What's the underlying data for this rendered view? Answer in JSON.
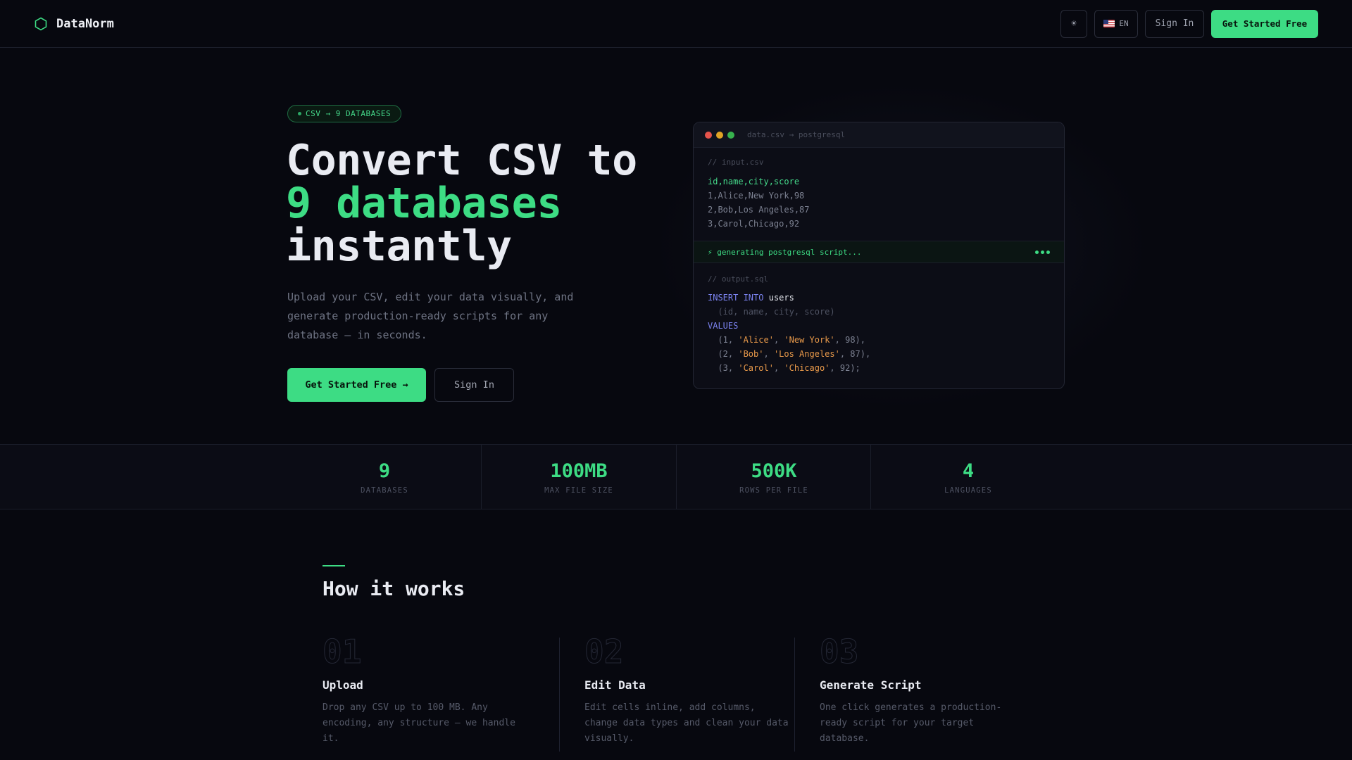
{
  "nav": {
    "brand": "DataNorm",
    "theme_icon": "sun-icon",
    "lang_code": "EN",
    "sign_in": "Sign In",
    "get_started": "Get Started Free"
  },
  "hero": {
    "badge": "CSV → 9 DATABASES",
    "title_line1": "Convert CSV to",
    "title_line2": "9 databases",
    "title_line3": "instantly",
    "subtitle": "Upload your CSV, edit your data visually, and generate production-ready scripts for any database — in seconds.",
    "cta_primary": "Get Started Free →",
    "cta_secondary": "Sign In"
  },
  "code_window": {
    "title": "data.csv → postgresql",
    "input_comment": "// input.csv",
    "csv_header": "id,name,city,score",
    "csv_rows": [
      "1,Alice,New York,98",
      "2,Bob,Los Angeles,87",
      "3,Carol,Chicago,92"
    ],
    "status": "⚡ generating postgresql script...",
    "output_comment": "// output.sql",
    "sql": {
      "insert_kw": "INSERT INTO",
      "table": "users",
      "columns": "(id, name, city, score)",
      "values_kw": "VALUES",
      "rows": [
        {
          "open": "(1, ",
          "name": "'Alice'",
          "sep": ", ",
          "city": "'New York'",
          "tail": ", 98),"
        },
        {
          "open": "(2, ",
          "name": "'Bob'",
          "sep": ", ",
          "city": "'Los Angeles'",
          "tail": ", 87),"
        },
        {
          "open": "(3, ",
          "name": "'Carol'",
          "sep": ", ",
          "city": "'Chicago'",
          "tail": ", 92);"
        }
      ]
    }
  },
  "stats": [
    {
      "value": "9",
      "label": "DATABASES"
    },
    {
      "value": "100MB",
      "label": "MAX FILE SIZE"
    },
    {
      "value": "500K",
      "label": "ROWS PER FILE"
    },
    {
      "value": "4",
      "label": "LANGUAGES"
    }
  ],
  "how_it_works": {
    "title": "How it works",
    "steps": [
      {
        "num": "01",
        "title": "Upload",
        "desc": "Drop any CSV up to 100 MB. Any encoding, any structure — we handle it."
      },
      {
        "num": "02",
        "title": "Edit Data",
        "desc": "Edit cells inline, add columns, change data types and clean your data visually."
      },
      {
        "num": "03",
        "title": "Generate Script",
        "desc": "One click generates a production-ready script for your target database."
      }
    ]
  },
  "colors": {
    "accent": "#3ddc84",
    "background": "#07080f",
    "sql_keyword": "#7b83f0",
    "sql_string": "#e8994a"
  }
}
